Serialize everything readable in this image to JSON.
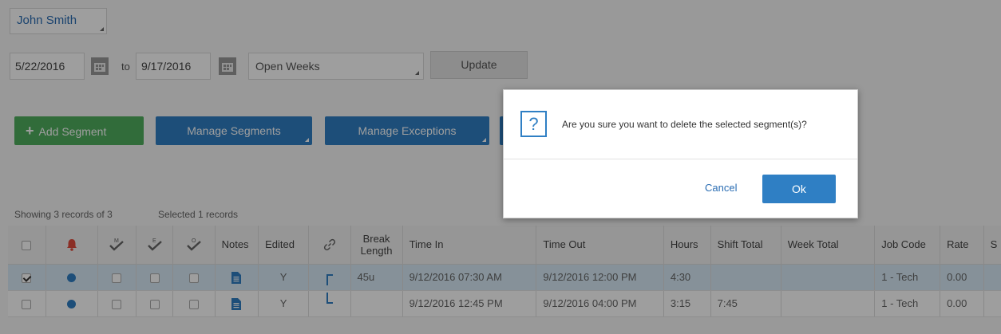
{
  "header": {
    "employee_name": "John Smith",
    "start_date": "5/22/2016",
    "to_label": "to",
    "end_date": "9/17/2016",
    "week_filter": "Open Weeks",
    "update_label": "Update"
  },
  "actions": {
    "add_segment": "Add Segment",
    "manage_segments": "Manage Segments",
    "manage_exceptions": "Manage Exceptions"
  },
  "status": {
    "showing": "Showing 3 records of 3",
    "selected": "Selected 1 records"
  },
  "columns": {
    "m_mark": "M",
    "e_mark": "E",
    "o_mark": "O",
    "notes": "Notes",
    "edited": "Edited",
    "break_length": "Break Length",
    "time_in": "Time In",
    "time_out": "Time Out",
    "hours": "Hours",
    "shift_total": "Shift Total",
    "week_total": "Week Total",
    "job_code": "Job Code",
    "rate": "Rate",
    "extra": "S"
  },
  "rows": [
    {
      "selected": true,
      "edited": "Y",
      "break_length": "45u",
      "time_in": "9/12/2016 07:30 AM",
      "time_out": "9/12/2016 12:00 PM",
      "hours": "4:30",
      "shift_total": "",
      "week_total": "",
      "job_code": "1 - Tech",
      "rate": "0.00"
    },
    {
      "selected": false,
      "edited": "Y",
      "break_length": "",
      "time_in": "9/12/2016 12:45 PM",
      "time_out": "9/12/2016 04:00 PM",
      "hours": "3:15",
      "shift_total": "7:45",
      "week_total": "",
      "job_code": "1 - Tech",
      "rate": "0.00"
    }
  ],
  "dialog": {
    "icon": "?",
    "message": "Are you sure you want to delete the selected segment(s)?",
    "cancel_label": "Cancel",
    "ok_label": "Ok"
  },
  "colors": {
    "accent_blue": "#2f7fc4",
    "add_green": "#4fae5e",
    "alert_red": "#e04b3c",
    "selected_row": "#d8ebf7"
  }
}
